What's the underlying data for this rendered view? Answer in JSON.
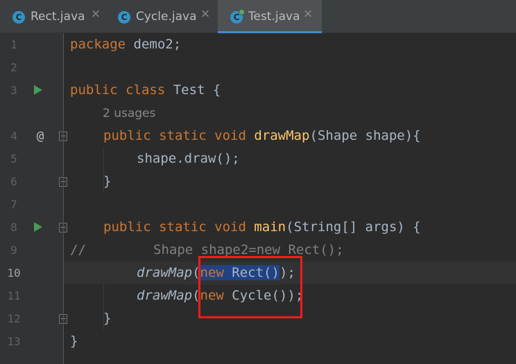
{
  "tabs": [
    {
      "label": "Rect.java",
      "icon": "class-icon",
      "icon_letter": "C",
      "active": false
    },
    {
      "label": "Cycle.java",
      "icon": "class-icon",
      "icon_letter": "C",
      "active": false
    },
    {
      "label": "Test.java",
      "icon": "class-runnable-icon",
      "icon_letter": "C",
      "active": true
    }
  ],
  "close_glyph": "×",
  "gutter": {
    "line_numbers": [
      "1",
      "2",
      "3",
      "4",
      "5",
      "6",
      "7",
      "8",
      "9",
      "10",
      "11",
      "12",
      "13"
    ],
    "current_line": "10",
    "override_glyph": "@"
  },
  "code": {
    "l1": {
      "kw": "package",
      "rest": " demo2;"
    },
    "l3": {
      "kw": "public class",
      "rest": " Test {"
    },
    "usages": "2 usages",
    "l4": {
      "kw": "public static void",
      "name": "drawMap",
      "rest": "(Shape shape){"
    },
    "l5": {
      "text": "shape.draw();"
    },
    "l6": {
      "text": "}"
    },
    "l8": {
      "kw": "public static void",
      "name": "main",
      "rest": "(String[] args) {"
    },
    "l9": {
      "marker": "//",
      "text": "Shape shape2=new Rect();"
    },
    "l10": {
      "call": "drawMap",
      "open": "(",
      "sel_kw": "new",
      "sel_rest": " Rect()",
      "tail": ");"
    },
    "l11": {
      "call": "drawMap",
      "open": "(",
      "kw": "new",
      "rest": " Cycle())",
      "tail": ";"
    },
    "l12": {
      "text": "}"
    },
    "l13": {
      "text": "}"
    }
  },
  "colors": {
    "background": "#2b2b2b",
    "keyword": "#cc7832",
    "method_decl": "#ffc66d",
    "selection": "#214283",
    "annotation_box": "#ff1a1a",
    "run_icon": "#499c54"
  }
}
